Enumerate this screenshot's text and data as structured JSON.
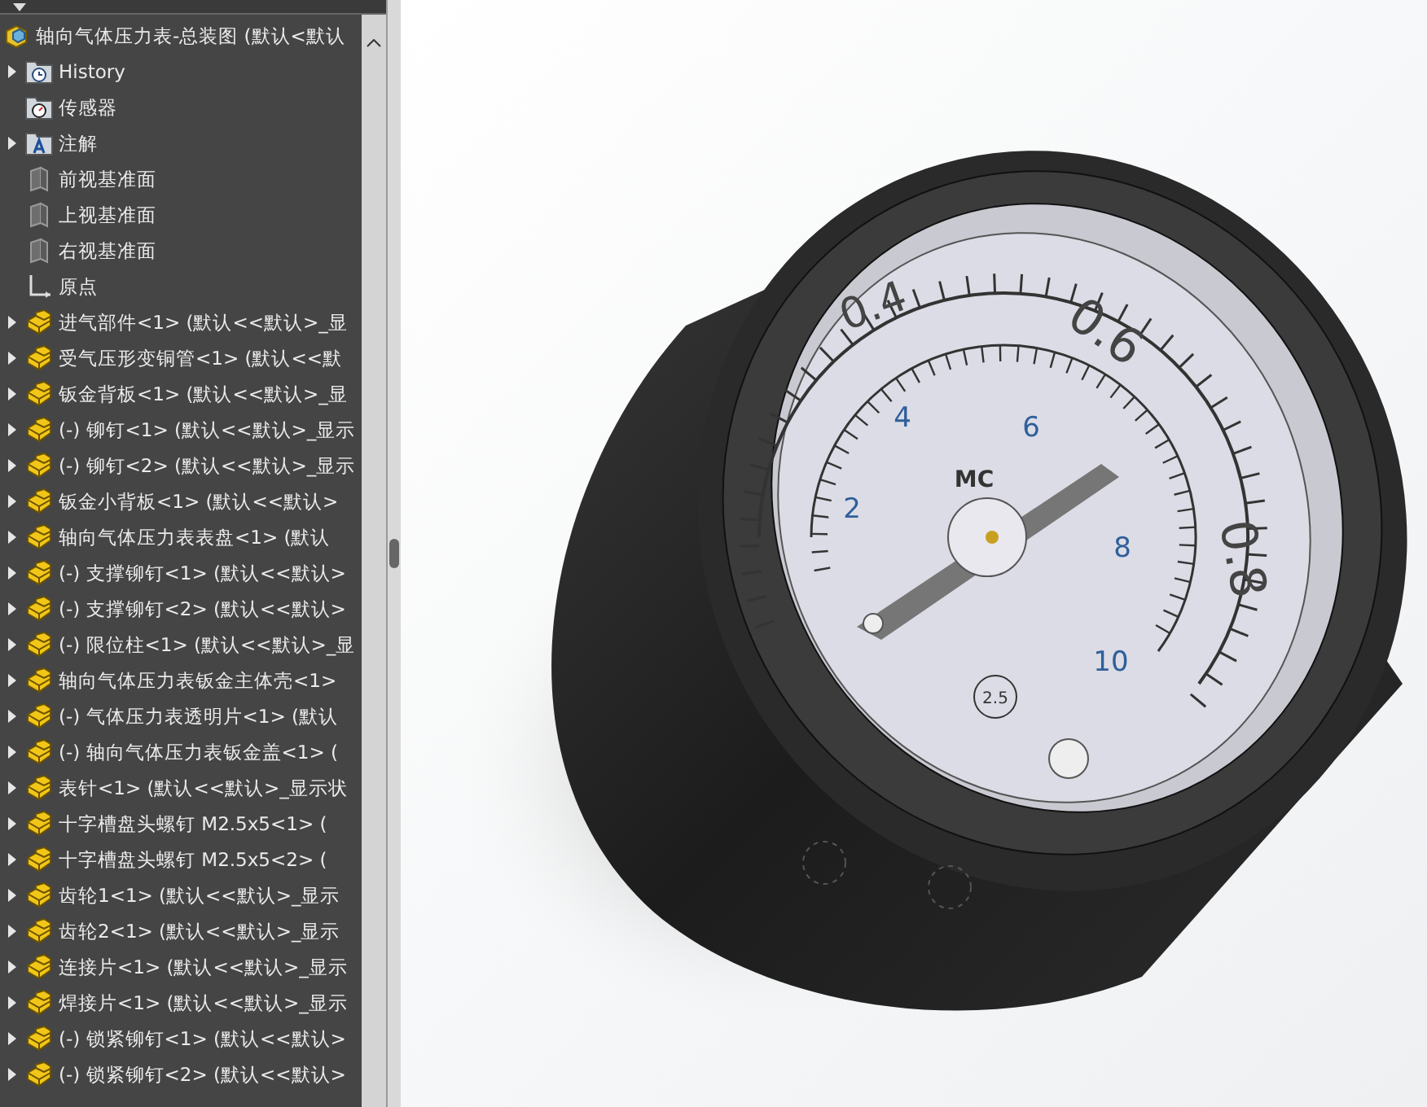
{
  "tree": {
    "root": {
      "label": "轴向气体压力表-总装图  (默认<默认"
    },
    "items": [
      {
        "kind": "history",
        "label": "History",
        "expandable": true
      },
      {
        "kind": "sensor",
        "label": "传感器",
        "expandable": false
      },
      {
        "kind": "annotation",
        "label": "注解",
        "expandable": true
      },
      {
        "kind": "plane",
        "label": "前视基准面",
        "expandable": false
      },
      {
        "kind": "plane",
        "label": "上视基准面",
        "expandable": false
      },
      {
        "kind": "plane",
        "label": "右视基准面",
        "expandable": false
      },
      {
        "kind": "origin",
        "label": "原点",
        "expandable": false
      },
      {
        "kind": "part",
        "label": "进气部件<1> (默认<<默认>_显",
        "expandable": true
      },
      {
        "kind": "part",
        "label": "受气压形变铜管<1> (默认<<默",
        "expandable": true
      },
      {
        "kind": "part",
        "label": "钣金背板<1> (默认<<默认>_显",
        "expandable": true
      },
      {
        "kind": "part",
        "label": "(-) 铆钉<1> (默认<<默认>_显示",
        "expandable": true
      },
      {
        "kind": "part",
        "label": "(-) 铆钉<2> (默认<<默认>_显示",
        "expandable": true
      },
      {
        "kind": "part",
        "label": "钣金小背板<1> (默认<<默认>",
        "expandable": true
      },
      {
        "kind": "part",
        "label": "轴向气体压力表表盘<1> (默认",
        "expandable": true
      },
      {
        "kind": "part",
        "label": "(-) 支撑铆钉<1> (默认<<默认>",
        "expandable": true
      },
      {
        "kind": "part",
        "label": "(-) 支撑铆钉<2> (默认<<默认>",
        "expandable": true
      },
      {
        "kind": "part",
        "label": "(-) 限位柱<1> (默认<<默认>_显",
        "expandable": true
      },
      {
        "kind": "part",
        "label": "轴向气体压力表钣金主体壳<1>",
        "expandable": true
      },
      {
        "kind": "part",
        "label": "(-) 气体压力表透明片<1> (默认",
        "expandable": true
      },
      {
        "kind": "part",
        "label": "(-) 轴向气体压力表钣金盖<1> (",
        "expandable": true
      },
      {
        "kind": "part",
        "label": "表针<1> (默认<<默认>_显示状",
        "expandable": true
      },
      {
        "kind": "part",
        "label": "十字槽盘头螺钉 M2.5x5<1> (",
        "expandable": true
      },
      {
        "kind": "part",
        "label": "十字槽盘头螺钉 M2.5x5<2> (",
        "expandable": true
      },
      {
        "kind": "part",
        "label": "齿轮1<1> (默认<<默认>_显示",
        "expandable": true
      },
      {
        "kind": "part",
        "label": "齿轮2<1> (默认<<默认>_显示",
        "expandable": true
      },
      {
        "kind": "part",
        "label": "连接片<1> (默认<<默认>_显示",
        "expandable": true
      },
      {
        "kind": "part",
        "label": "焊接片<1> (默认<<默认>_显示",
        "expandable": true
      },
      {
        "kind": "part",
        "label": "(-) 锁紧铆钉<1> (默认<<默认>",
        "expandable": true
      },
      {
        "kind": "part",
        "label": "(-) 锁紧铆钉<2> (默认<<默认>",
        "expandable": true
      }
    ]
  },
  "viewport": {
    "dial": {
      "outer_scale": [
        "0.4",
        "0.6",
        "0.8"
      ],
      "inner_scale": [
        "2",
        "4",
        "6",
        "8",
        "10"
      ],
      "logo": "MC",
      "accuracy_class": "2.5"
    }
  }
}
